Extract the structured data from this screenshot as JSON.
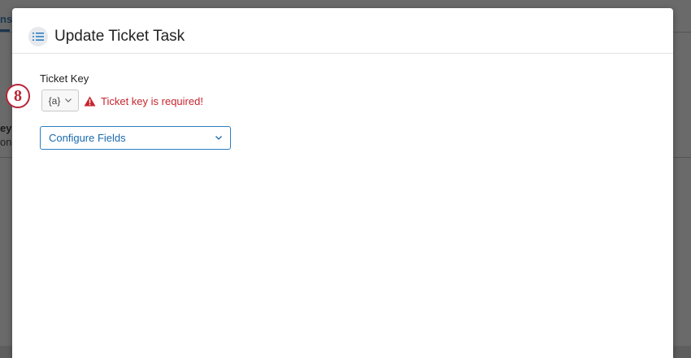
{
  "background": {
    "tab_label": "ns",
    "row_text_1": "ey",
    "row_text_2": "on"
  },
  "modal": {
    "title": "Update Ticket Task",
    "header_icon": "list-icon"
  },
  "ticket_key": {
    "label": "Ticket Key",
    "piped_text_label": "{a}",
    "error_message": "Ticket key is required!",
    "error_icon": "warning-triangle-icon"
  },
  "configure_fields": {
    "label": "Configure Fields"
  },
  "step_badge": {
    "number": "8"
  },
  "colors": {
    "accent": "#1a6aae",
    "error": "#c7252e",
    "badge": "#b8263a"
  }
}
